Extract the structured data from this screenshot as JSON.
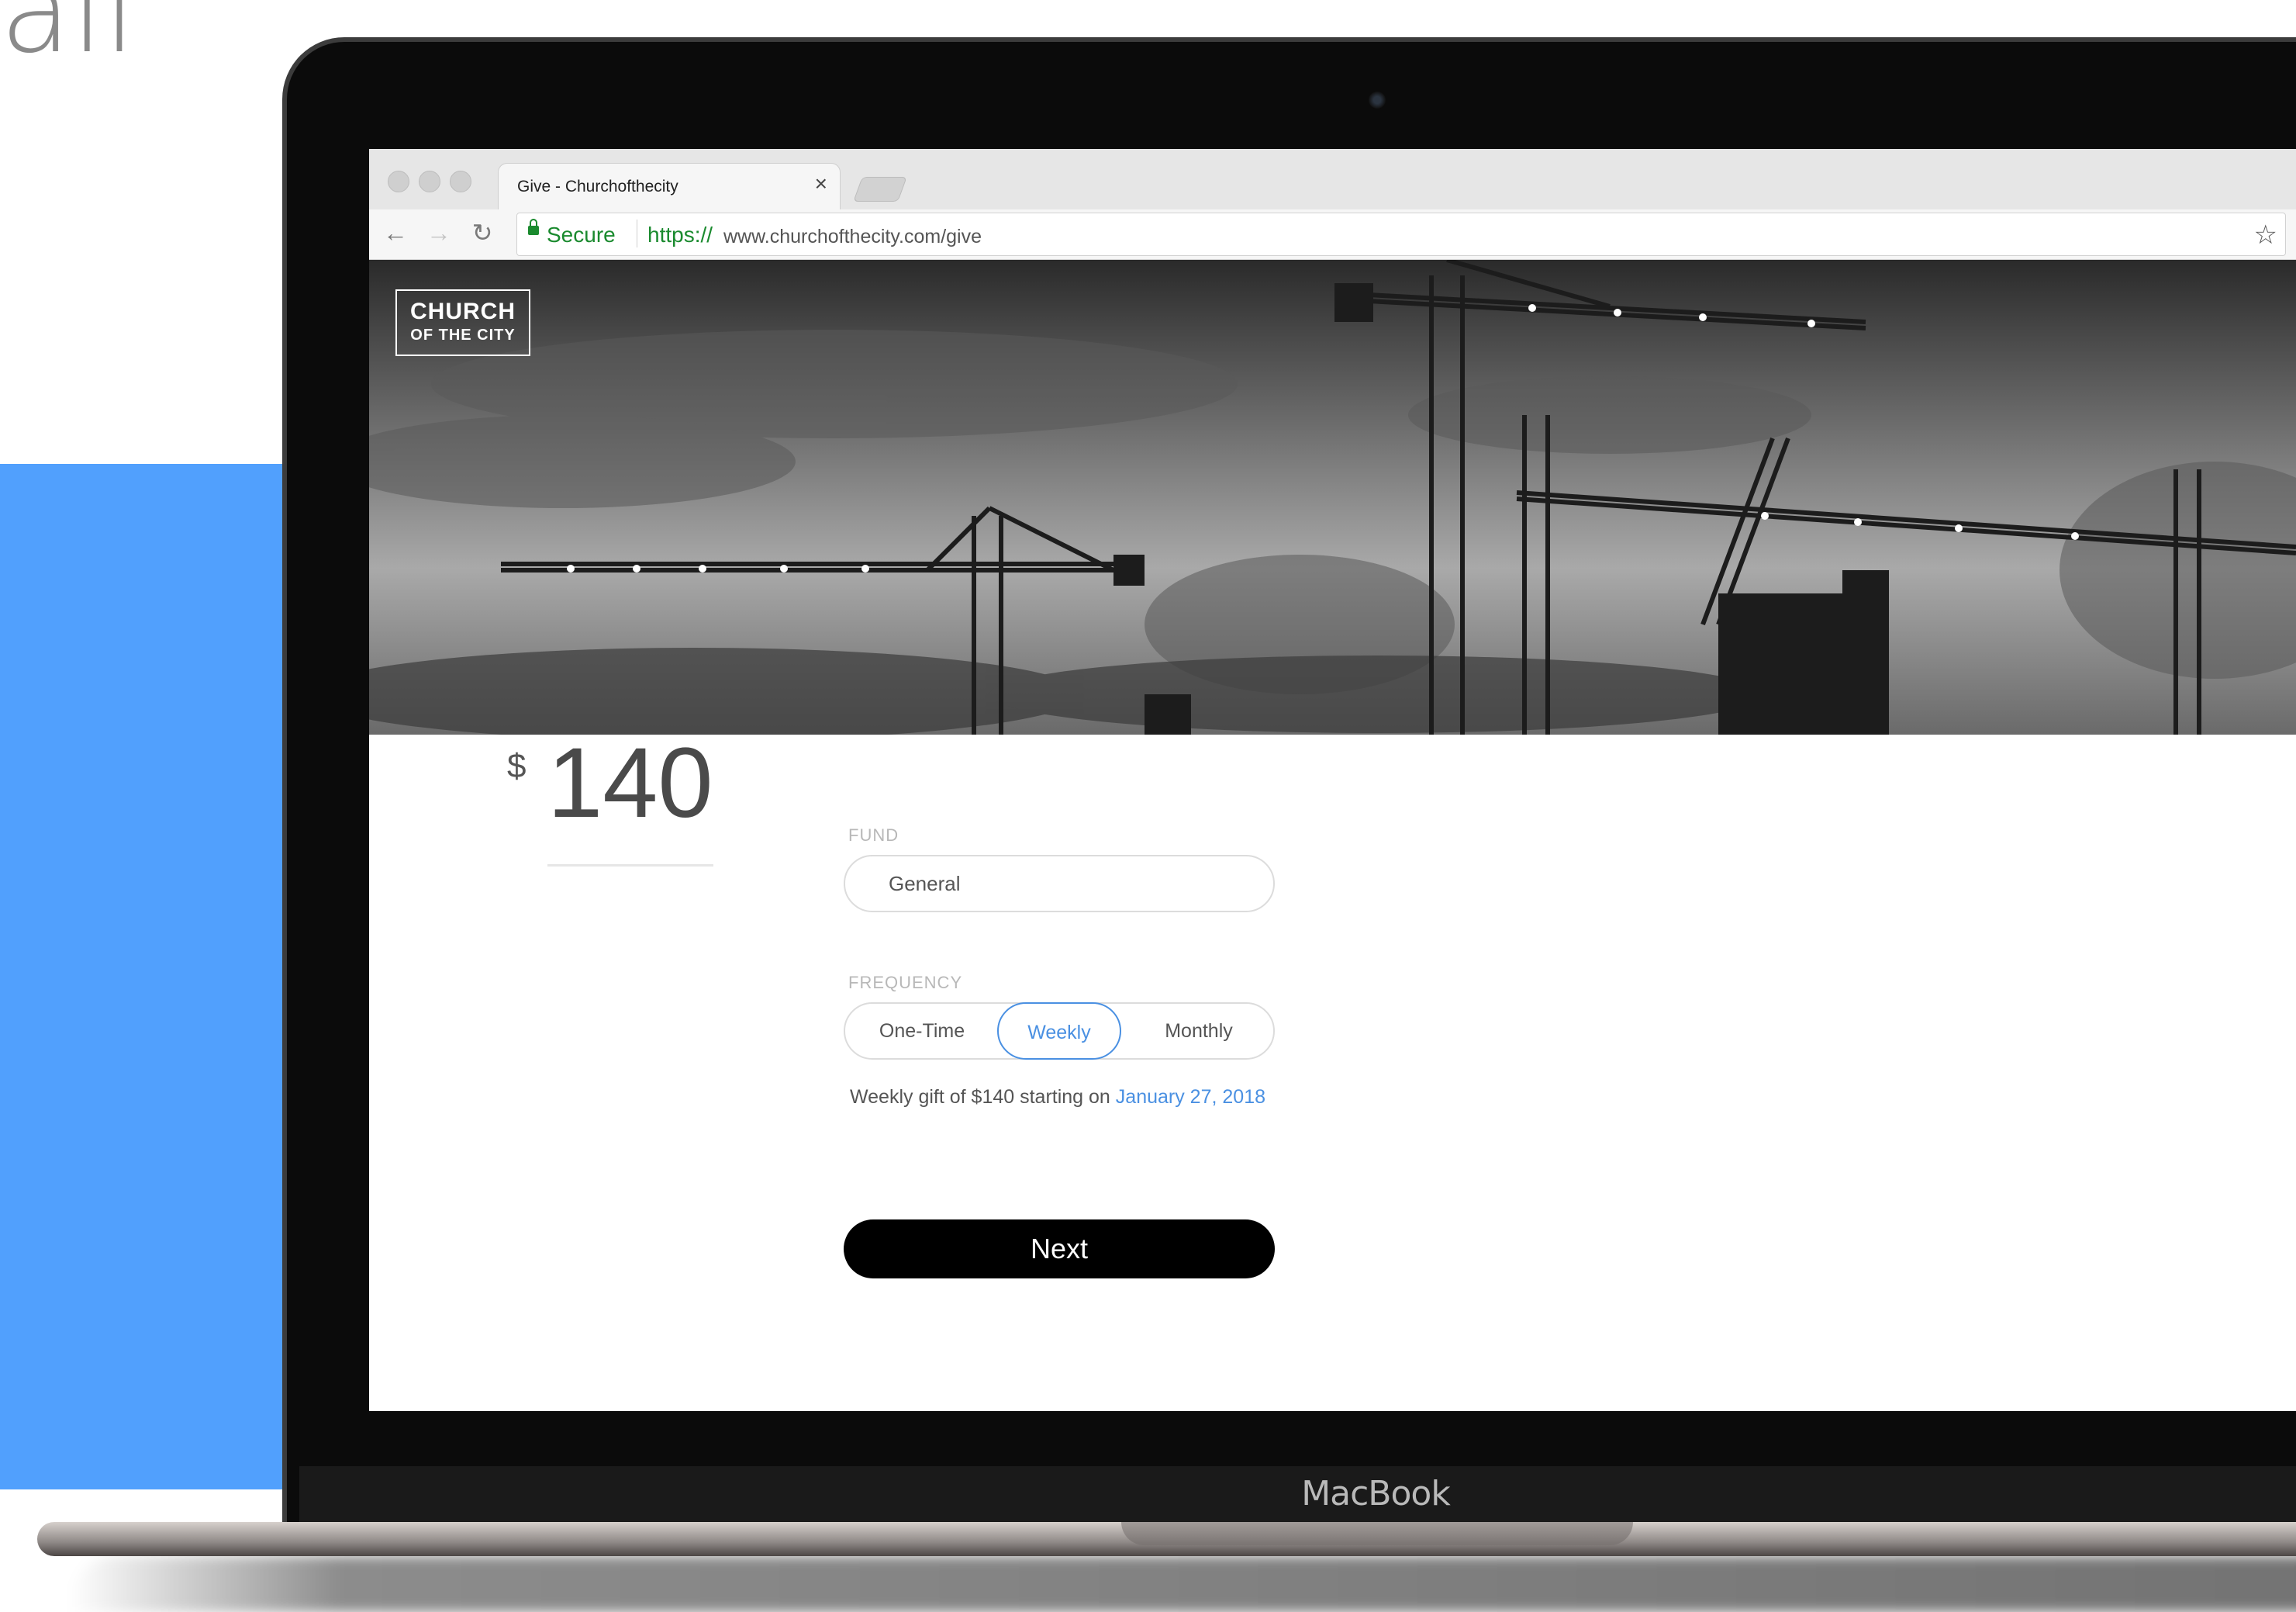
{
  "heading_fragment": "all",
  "device": {
    "brand": "MacBook"
  },
  "browser": {
    "tab_title": "Give - Churchofthecity",
    "secure_label": "Secure",
    "url_scheme": "https://",
    "url_rest": "www.churchofthecity.com/give"
  },
  "site": {
    "logo_line1": "CHURCH",
    "logo_line2": "OF THE CITY"
  },
  "form": {
    "currency_symbol": "$",
    "amount": "140",
    "fund_label": "FUND",
    "fund_value": "General",
    "frequency_label": "FREQUENCY",
    "frequency_options": [
      "One-Time",
      "Weekly",
      "Monthly"
    ],
    "frequency_selected": "Weekly",
    "summary_text": "Weekly gift of $140 starting on",
    "summary_date": "January 27, 2018",
    "next_label": "Next"
  },
  "colors": {
    "accent_blue": "#51a0fd",
    "link_blue": "#4a90e2",
    "secure_green": "#1a8a2e",
    "button_black": "#000000"
  }
}
